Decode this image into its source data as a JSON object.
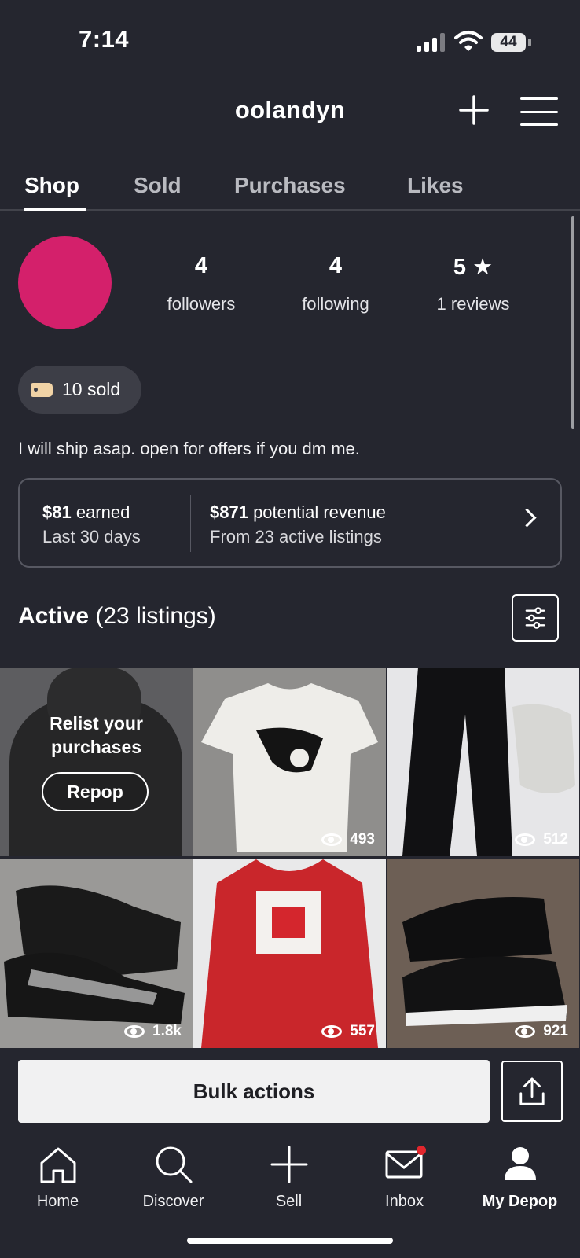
{
  "status_bar": {
    "time": "7:14",
    "battery": "44"
  },
  "header": {
    "username": "oolandyn"
  },
  "tabs": [
    {
      "label": "Shop",
      "active": true
    },
    {
      "label": "Sold",
      "active": false
    },
    {
      "label": "Purchases",
      "active": false
    },
    {
      "label": "Likes",
      "active": false
    }
  ],
  "profile": {
    "avatar_color": "#d4206b",
    "stats": [
      {
        "value": "4",
        "label": "followers"
      },
      {
        "value": "4",
        "label": "following"
      },
      {
        "value": "5 ★",
        "label": "1 reviews"
      }
    ],
    "sold_badge": "10 sold",
    "bio": "I will ship asap. open for offers if you dm me."
  },
  "earnings": {
    "earned_amount": "$81",
    "earned_word": " earned",
    "earned_period": "Last 30 days",
    "revenue_amount": "$871",
    "revenue_word": " potential revenue",
    "revenue_source": "From 23 active listings"
  },
  "active": {
    "title": "Active",
    "count": " (23 listings)"
  },
  "relist": {
    "line1": "Relist your",
    "line2": "purchases",
    "button": "Repop"
  },
  "listings": [
    {
      "item": "white-graphic-tshirt",
      "views": "493"
    },
    {
      "item": "black-patchwork-jeans",
      "views": "512"
    },
    {
      "item": "ugg-boots",
      "views": "1.8k"
    },
    {
      "item": "red-nike-hoodie",
      "views": "557"
    },
    {
      "item": "black-jordan-sneakers",
      "views": "921"
    }
  ],
  "actions": {
    "bulk": "Bulk actions"
  },
  "bottom_nav": [
    {
      "label": "Home",
      "icon": "home-icon"
    },
    {
      "label": "Discover",
      "icon": "search-icon"
    },
    {
      "label": "Sell",
      "icon": "plus-icon"
    },
    {
      "label": "Inbox",
      "icon": "mail-icon"
    },
    {
      "label": "My Depop",
      "icon": "person-icon",
      "active": true
    }
  ]
}
